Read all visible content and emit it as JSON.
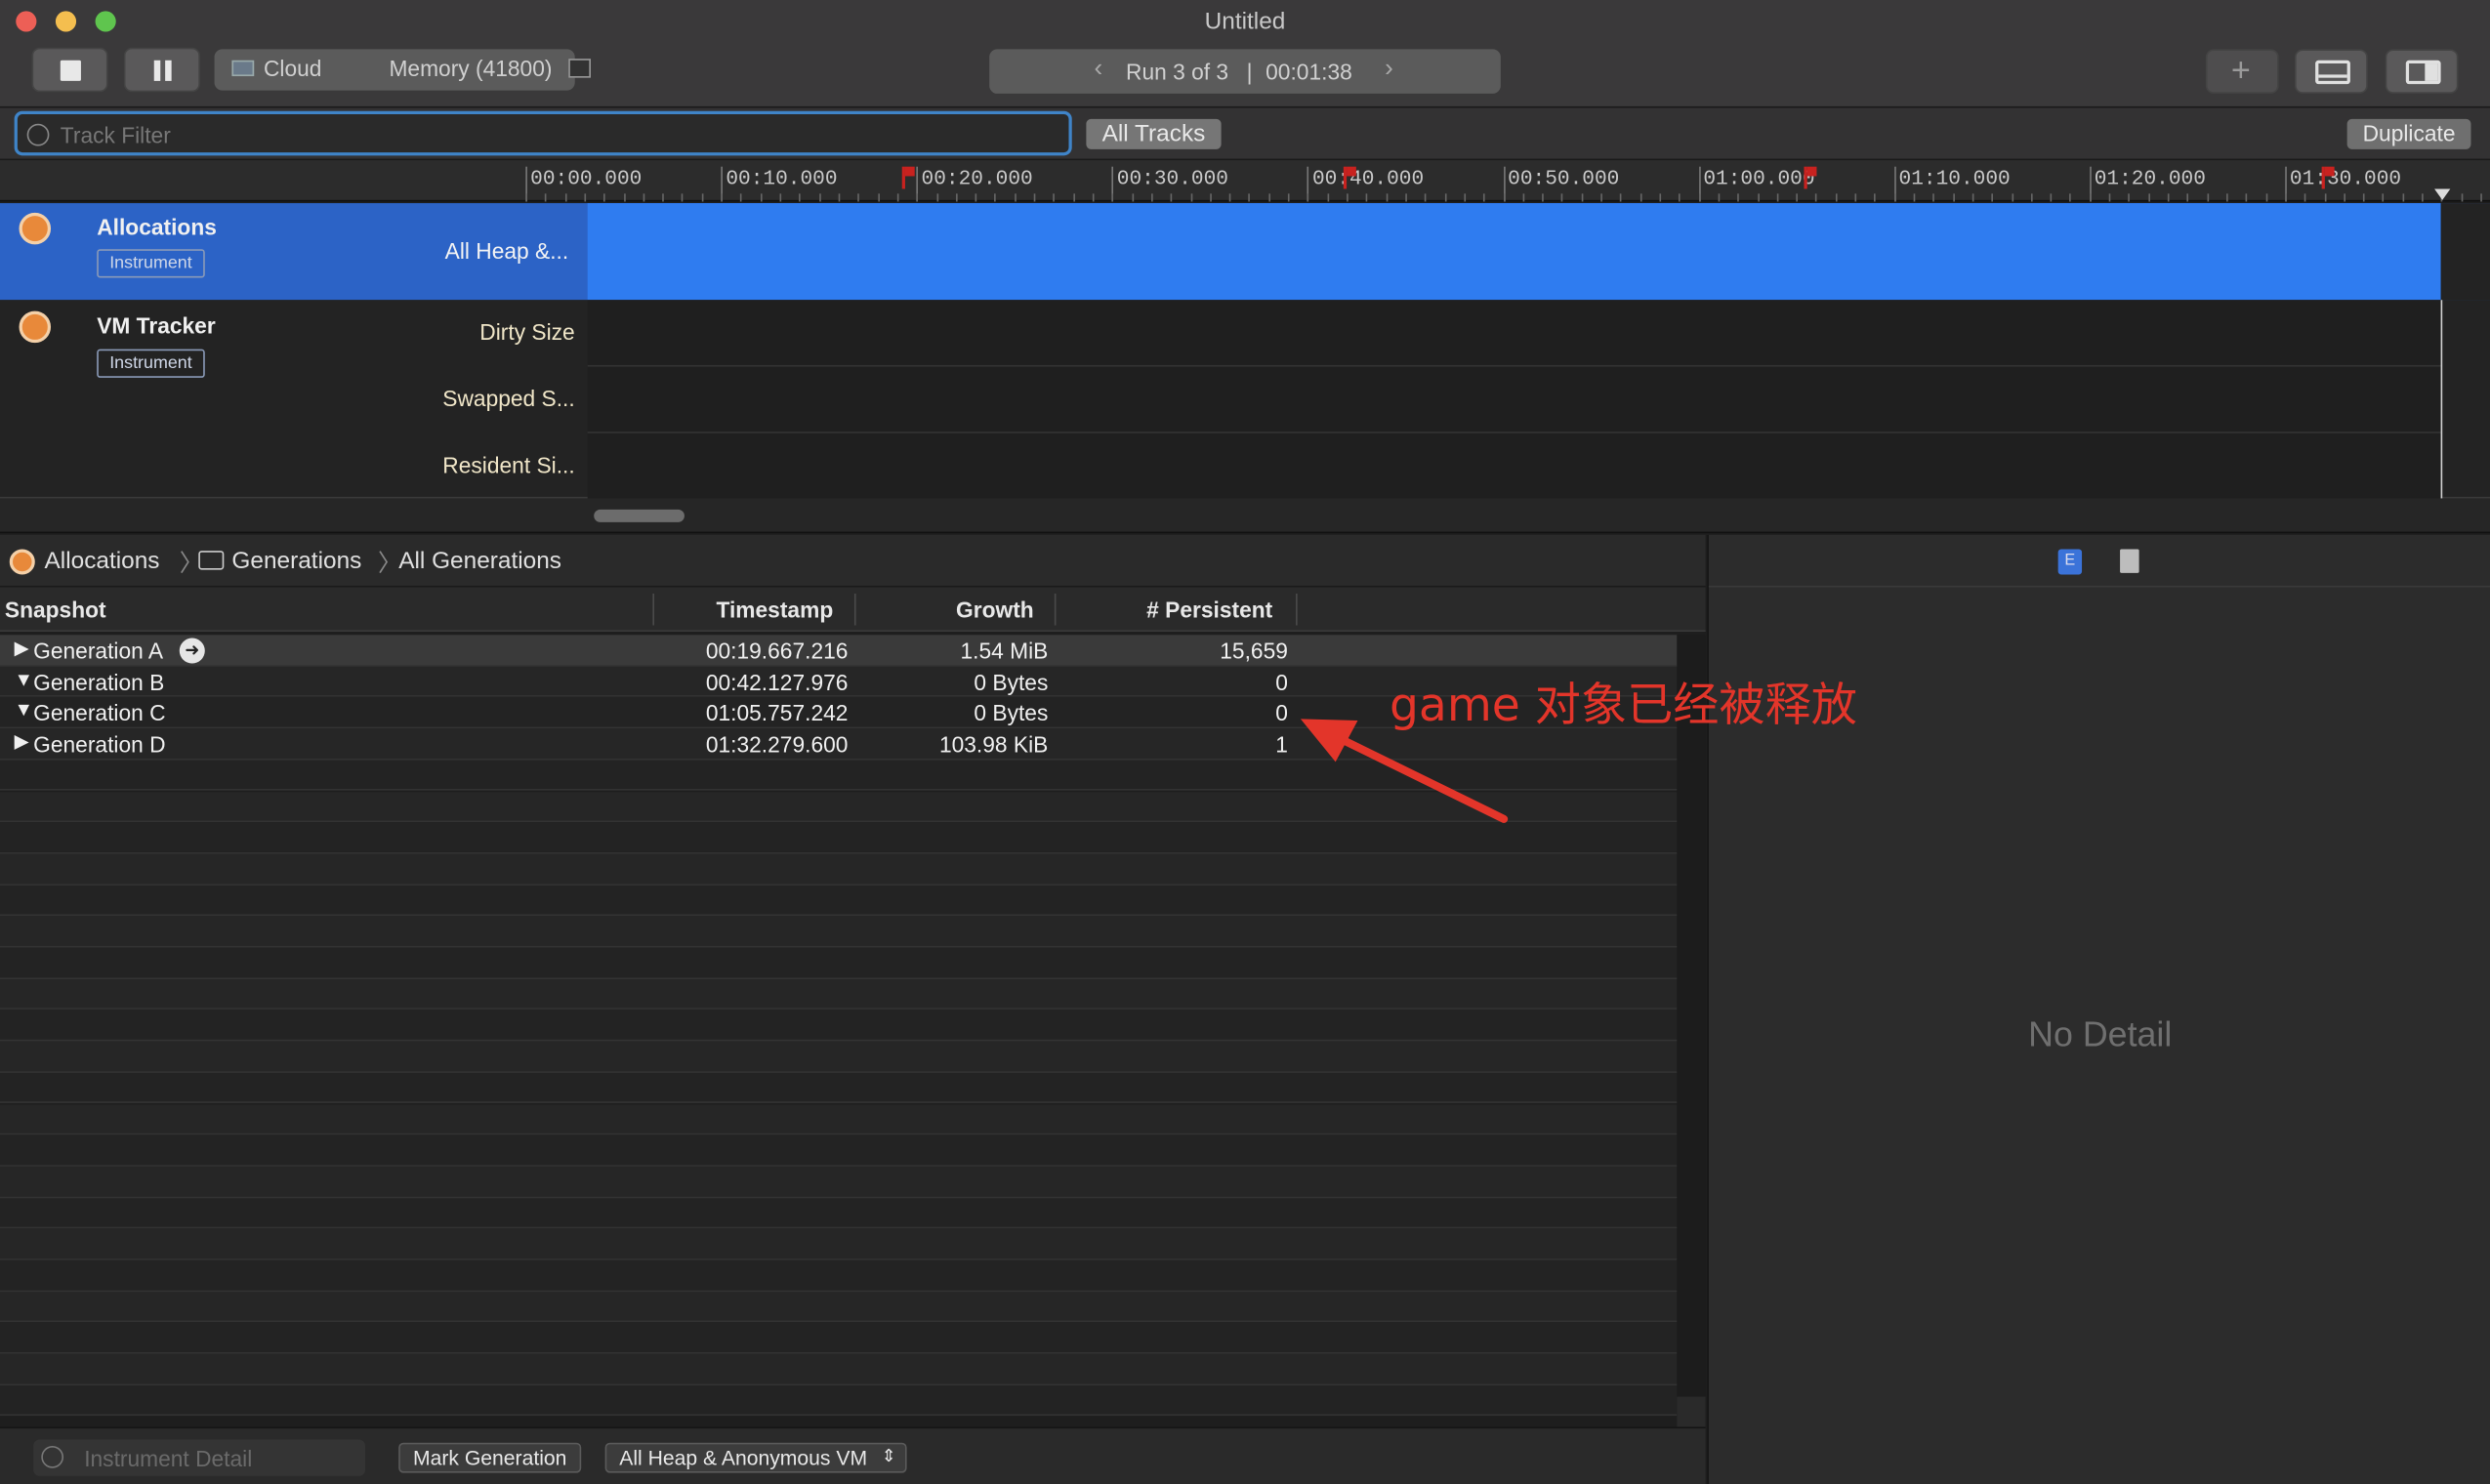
{
  "window": {
    "title": "Untitled"
  },
  "toolbar": {
    "target_device": "Cloud",
    "target_process": "Memory (41800)",
    "run_label": "Run 3 of 3",
    "run_sep": "|",
    "run_time": "00:01:38",
    "run_prev": "‹",
    "run_next": "›",
    "add_label": "+"
  },
  "filter": {
    "placeholder": "Track Filter",
    "all_tracks": "All Tracks",
    "duplicate": "Duplicate"
  },
  "ruler": {
    "ticks": [
      "00:00.000",
      "00:10.000",
      "00:20.000",
      "00:30.000",
      "00:40.000",
      "00:50.000",
      "01:00.000",
      "01:10.000",
      "01:20.000",
      "01:30.000"
    ]
  },
  "tracks": [
    {
      "name": "Allocations",
      "badge": "Instrument",
      "subs": [
        "All Heap &..."
      ]
    },
    {
      "name": "VM Tracker",
      "badge": "Instrument",
      "subs": [
        "Dirty Size",
        "Swapped S...",
        "Resident Si..."
      ]
    }
  ],
  "breadcrumb": {
    "root": "Allocations",
    "mid": "Generations",
    "leaf": "All Generations"
  },
  "table": {
    "headers": {
      "snapshot": "Snapshot",
      "timestamp": "Timestamp",
      "growth": "Growth",
      "persistent": "# Persistent"
    },
    "rows": [
      {
        "disclosure": "▶",
        "name": "Generation A",
        "timestamp": "00:19.667.216",
        "growth": "1.54 MiB",
        "persistent": "15,659"
      },
      {
        "disclosure": "▼",
        "name": "Generation B",
        "timestamp": "00:42.127.976",
        "growth": "0 Bytes",
        "persistent": "0"
      },
      {
        "disclosure": "▼",
        "name": "Generation C",
        "timestamp": "01:05.757.242",
        "growth": "0 Bytes",
        "persistent": "0"
      },
      {
        "disclosure": "▶",
        "name": "Generation D",
        "timestamp": "01:32.279.600",
        "growth": "103.98 KiB",
        "persistent": "1"
      }
    ]
  },
  "detail": {
    "empty_text": "No Detail",
    "tab_e": "E"
  },
  "bottom": {
    "detail_placeholder": "Instrument Detail",
    "mark_generation": "Mark Generation",
    "scope_select": "All Heap & Anonymous VM"
  },
  "annotation": {
    "text": "game 对象已经被释放",
    "color": "#e3352a"
  },
  "colors": {
    "selection": "#2f7cf0",
    "track_selected": "#1f5fd0",
    "accent_focus": "#3f84c8"
  }
}
